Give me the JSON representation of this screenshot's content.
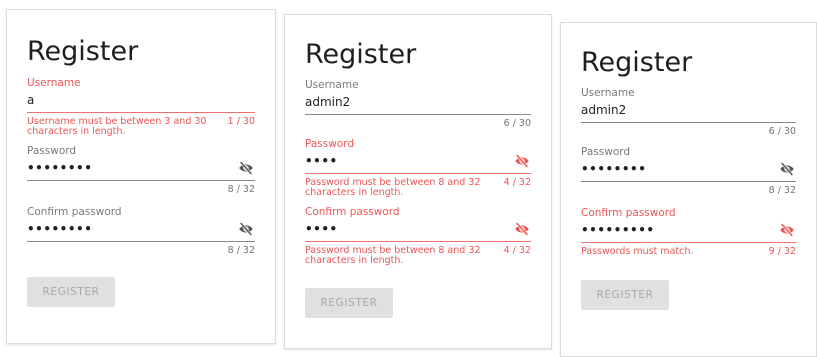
{
  "cards": [
    {
      "title": "Register",
      "username": {
        "label": "Username",
        "value": "a",
        "error": "Username must be between 3 and 30 characters in length.",
        "counter": "1 / 30"
      },
      "password": {
        "label": "Password",
        "value": "••••••••",
        "counter": "8 / 32"
      },
      "confirm": {
        "label": "Confirm password",
        "value": "••••••••",
        "counter": "8 / 32"
      },
      "button": "REGISTER"
    },
    {
      "title": "Register",
      "username": {
        "label": "Username",
        "value": "admin2",
        "counter": "6 / 30"
      },
      "password": {
        "label": "Password",
        "value": "••••",
        "error": "Password must be between 8 and 32 characters in length.",
        "counter": "4 / 32"
      },
      "confirm": {
        "label": "Confirm password",
        "value": "••••",
        "error": "Password must be between 8 and 32 characters in length.",
        "counter": "4 / 32"
      },
      "button": "REGISTER"
    },
    {
      "title": "Register",
      "username": {
        "label": "Username",
        "value": "admin2",
        "counter": "6 / 30"
      },
      "password": {
        "label": "Password",
        "value": "••••••••",
        "counter": "8 / 32"
      },
      "confirm": {
        "label": "Confirm password",
        "value": "•••••••••",
        "error": "Passwords must match.",
        "counter": "9 / 32"
      },
      "button": "REGISTER"
    }
  ],
  "colors": {
    "error": "#ee5555",
    "text": "#212121",
    "label": "#7a7a7a",
    "button_bg": "#e0e0e0",
    "button_text": "#a8a8a8"
  },
  "icons": {
    "visibility_toggle": "eye-off-icon"
  }
}
